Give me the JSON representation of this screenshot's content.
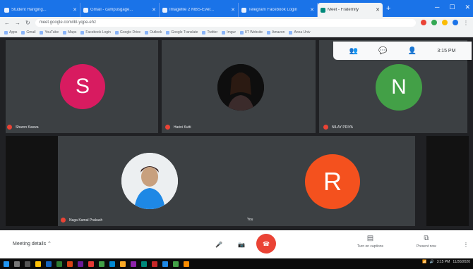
{
  "browser": {
    "tabs": [
      {
        "title": "Student Hanging..."
      },
      {
        "title": "Gmail - campusgage..."
      },
      {
        "title": "Imagefile 2 MBS-Ever..."
      },
      {
        "title": "Telegram Facebook Login"
      },
      {
        "title": "Meet - Fraternity",
        "active": true
      }
    ],
    "new_tab": "+",
    "url": "meet.google.com/ibl-yqpe-ehz",
    "bookmarks": [
      "Apps",
      "Gmail",
      "YouTube",
      "Maps",
      "Facebook Login",
      "Google Drive",
      "Outlook",
      "Google Translate",
      "Twitter",
      "Imgur",
      "IIT Website",
      "Amazon",
      "Anna Univ"
    ]
  },
  "meeting": {
    "participants": [
      {
        "initial": "S",
        "name": "Sharon Kaswa",
        "color": "#d81b60"
      },
      {
        "initial": "",
        "name": "Harini Kutti",
        "color": "#111111"
      },
      {
        "initial": "N",
        "name": "NILAY PRIYA",
        "color": "#43a047"
      },
      {
        "initial": "",
        "name": "Naga Kamal Prakash",
        "color": "#eeeeee"
      },
      {
        "initial": "R",
        "name": "",
        "color": "#f4511e"
      }
    ],
    "self_label": "You",
    "time": "3:15 PM"
  },
  "controls": {
    "meeting_details": "Meeting details",
    "end_call": "end",
    "turn_on_captions": "Turn on captions",
    "present_now": "Present now"
  },
  "taskbar": {
    "clock": "3:15 PM",
    "date": "11/30/2020"
  }
}
